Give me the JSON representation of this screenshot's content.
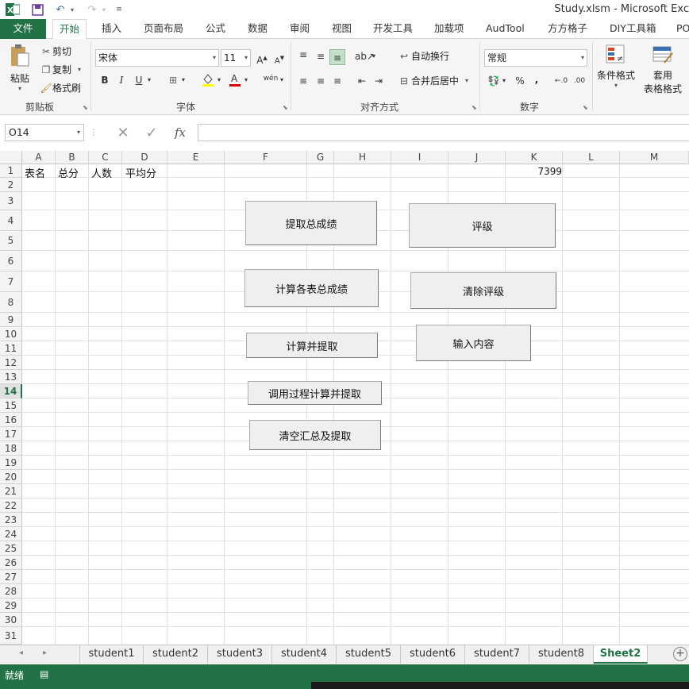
{
  "title_bar": {
    "title": "Study.xlsm - Microsoft Exc",
    "excel_icon": "excel-logo-icon",
    "save_icon": "save-icon",
    "undo_icon": "undo-icon",
    "redo_icon": "redo-icon"
  },
  "tabs": [
    "文件",
    "开始",
    "插入",
    "页面布局",
    "公式",
    "数据",
    "审阅",
    "视图",
    "开发工具",
    "加载项",
    "AudTool",
    "方方格子",
    "DIY工具箱",
    "PO"
  ],
  "active_tab": "开始",
  "ribbon": {
    "clipboard": {
      "paste": "粘贴",
      "cut": "剪切",
      "copy": "复制",
      "format_painter": "格式刷",
      "label": "剪贴板"
    },
    "font": {
      "font_name": "宋体",
      "font_size": "11",
      "bold": "B",
      "italic": "I",
      "underline": "U",
      "phonetic": "wén",
      "label": "字体"
    },
    "alignment": {
      "wrap_text": "自动换行",
      "merge_center": "合并后居中",
      "label": "对齐方式"
    },
    "number": {
      "format": "常规",
      "percent": "%",
      "comma": ",",
      "label": "数字"
    },
    "styles": {
      "conditional_format": "条件格式",
      "table_format_1": "套用",
      "table_format_2": "表格格式"
    }
  },
  "formula_bar": {
    "name_box": "O14",
    "fx": "fx",
    "formula": ""
  },
  "columns": [
    "A",
    "B",
    "C",
    "D",
    "E",
    "F",
    "G",
    "H",
    "I",
    "J",
    "K",
    "L",
    "M"
  ],
  "rows": [
    "1",
    "2",
    "3",
    "4",
    "5",
    "6",
    "7",
    "8",
    "9",
    "10",
    "11",
    "12",
    "13",
    "14",
    "15",
    "16",
    "17",
    "18",
    "19",
    "20",
    "21",
    "22",
    "23",
    "24",
    "25",
    "26",
    "27",
    "28",
    "29",
    "30",
    "31"
  ],
  "active_row": "14",
  "cells": {
    "A1": "表名",
    "B1": "总分",
    "C1": "人数",
    "D1": "平均分",
    "K1": "7399"
  },
  "sheet_buttons": {
    "extract_total": "提取总成绩",
    "rating": "评级",
    "calc_each_total": "计算各表总成绩",
    "clear_rating": "清除评级",
    "calc_and_extract": "计算并提取",
    "input_content": "输入内容",
    "call_proc_calc_extract": "调用过程计算并提取",
    "clear_summary_extract": "清空汇总及提取"
  },
  "sheets": [
    "student1",
    "student2",
    "student3",
    "student4",
    "student5",
    "student6",
    "student7",
    "student8",
    "Sheet2"
  ],
  "active_sheet": "Sheet2",
  "status": {
    "ready": "就绪"
  },
  "colors": {
    "excel_green": "#217346"
  }
}
